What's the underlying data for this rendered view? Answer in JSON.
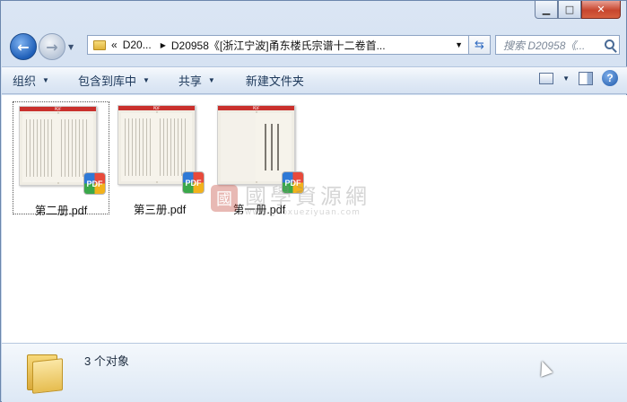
{
  "window": {
    "caption": {
      "minimize": "▁",
      "maximize": "□",
      "close": "✕"
    }
  },
  "nav": {
    "back_icon": "arrow-left-icon",
    "forward_icon": "arrow-right-icon"
  },
  "address": {
    "prefix": "«",
    "crumb1": "D20...",
    "crumb2": "D20958《[浙江宁波]甬东楼氏宗谱十二卷首..."
  },
  "search": {
    "placeholder": "搜索 D20958《..."
  },
  "toolbar": {
    "organize": "组织",
    "include_library": "包含到库中",
    "share": "共享",
    "new_folder": "新建文件夹"
  },
  "files": [
    {
      "name": "第二册.pdf",
      "selected": true
    },
    {
      "name": "第三册.pdf",
      "selected": false
    },
    {
      "name": "第一册.pdf",
      "selected": false
    }
  ],
  "thumb_band_label": "PDF",
  "pdf_badge_label": "PDF",
  "watermark": {
    "title": "國學資源網",
    "url": "www.guoxueziyuan.com",
    "logo": "國"
  },
  "status": {
    "count": "3 个对象"
  }
}
